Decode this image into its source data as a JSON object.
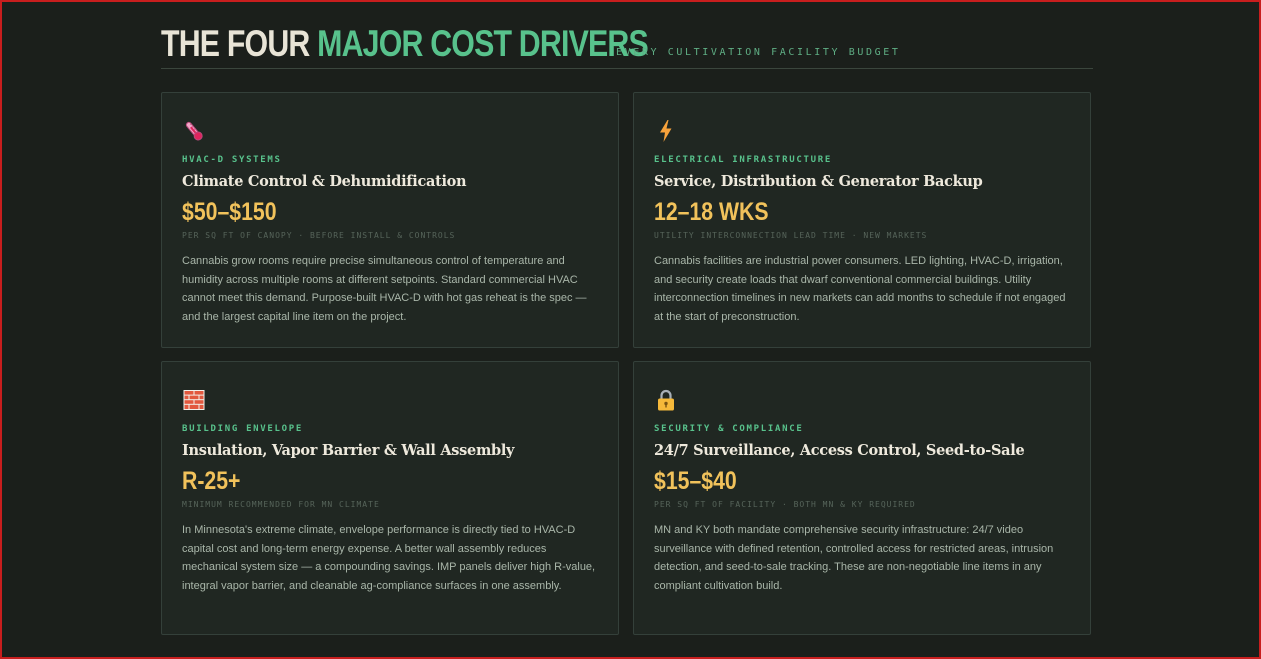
{
  "header": {
    "title_light": "THE FOUR",
    "title_accent": "MAJOR COST DRIVERS",
    "subtitle": "EVERY CULTIVATION FACILITY BUDGET"
  },
  "colors": {
    "accent_green": "#58c28c",
    "accent_gold": "#f1c25b",
    "background": "#1b1f1b"
  },
  "cards": [
    {
      "icon": "thermometer-icon",
      "category": "HVAC-D SYSTEMS",
      "title": "Climate Control & Dehumidification",
      "stat": "$50–$150",
      "note": "PER SQ FT OF CANOPY · BEFORE INSTALL & CONTROLS",
      "description": "Cannabis grow rooms require precise simultaneous control of temperature and humidity across multiple rooms at different setpoints. Standard commercial HVAC cannot meet this demand. Purpose-built HVAC-D with hot gas reheat is the spec — and the largest capital line item on the project."
    },
    {
      "icon": "lightning-icon",
      "category": "ELECTRICAL INFRASTRUCTURE",
      "title": "Service, Distribution & Generator Backup",
      "stat": "12–18 WKS",
      "note": "UTILITY INTERCONNECTION LEAD TIME · NEW MARKETS",
      "description": "Cannabis facilities are industrial power consumers. LED lighting, HVAC-D, irrigation, and security create loads that dwarf conventional commercial buildings. Utility interconnection timelines in new markets can add months to schedule if not engaged at the start of preconstruction."
    },
    {
      "icon": "brick-icon",
      "category": "BUILDING ENVELOPE",
      "title": "Insulation, Vapor Barrier & Wall Assembly",
      "stat": "R-25+",
      "note": "MINIMUM RECOMMENDED FOR MN CLIMATE",
      "description": "In Minnesota's extreme climate, envelope performance is directly tied to HVAC-D capital cost and long-term energy expense. A better wall assembly reduces mechanical system size — a compounding savings. IMP panels deliver high R-value, integral vapor barrier, and cleanable ag-compliance surfaces in one assembly."
    },
    {
      "icon": "lock-icon",
      "category": "SECURITY & COMPLIANCE",
      "title": "24/7 Surveillance, Access Control, Seed-to-Sale",
      "stat": "$15–$40",
      "note": "PER SQ FT OF FACILITY · BOTH MN & KY REQUIRED",
      "description": "MN and KY both mandate comprehensive security infrastructure: 24/7 video surveillance with defined retention, controlled access for restricted areas, intrusion detection, and seed-to-sale tracking. These are non-negotiable line items in any compliant cultivation build."
    }
  ]
}
